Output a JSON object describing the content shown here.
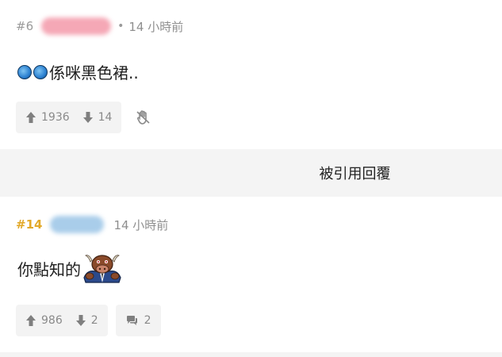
{
  "posts": [
    {
      "floor": "#6",
      "separator": "•",
      "time": "14 小時前",
      "content_text": "係咪黑色裙..",
      "emoji_icons": [
        "blue-ball-emoji",
        "blue-ball-emoji"
      ],
      "upvotes": "1936",
      "downvotes": "14"
    },
    {
      "floor": "#14",
      "time": "14 小時前",
      "content_text": "你點知的",
      "emoji_icons": [
        "cow-head-emoji"
      ],
      "upvotes": "986",
      "downvotes": "2",
      "replies": "2"
    }
  ],
  "quote_bar": {
    "label": "被引用回覆"
  },
  "colors": {
    "op_floor": "#e2a92a",
    "vote_bg": "#f3f3f3",
    "divider_bg": "#f4f4f4"
  }
}
